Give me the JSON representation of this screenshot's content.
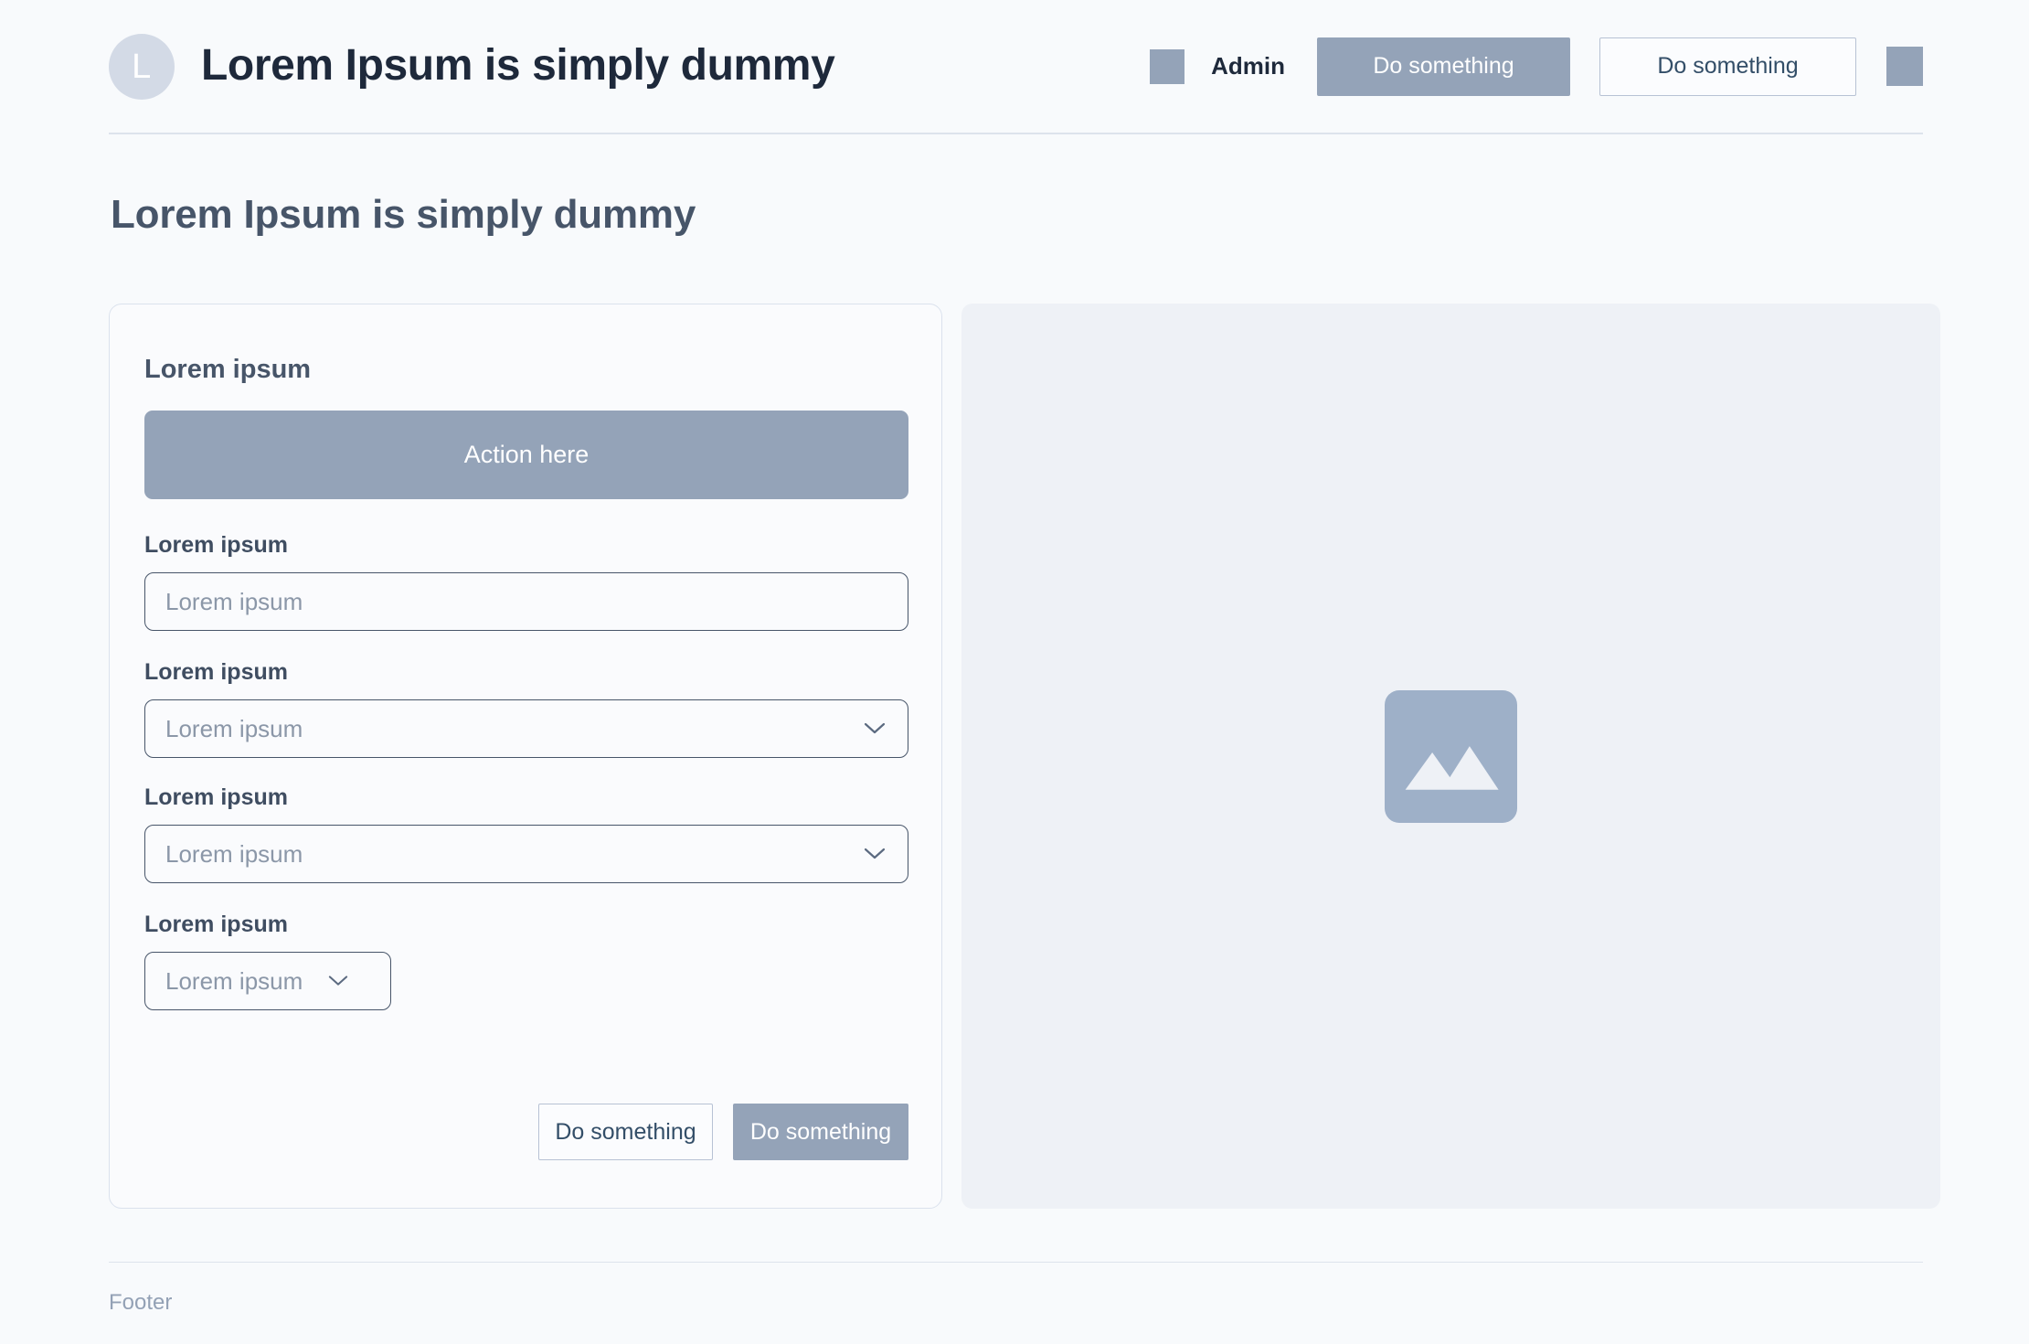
{
  "header": {
    "logo_initial": "L",
    "logo_icon": "avatar-letter-icon",
    "title": "Lorem Ipsum is simply dummy",
    "user_swatch_icon": "user-avatar-placeholder-icon",
    "user_label": "Admin",
    "primary_button": "Do something",
    "secondary_button": "Do something",
    "end_swatch_icon": "menu-placeholder-icon"
  },
  "page": {
    "title": "Lorem Ipsum is simply dummy"
  },
  "form_card": {
    "heading": "Lorem ipsum",
    "action_banner": "Action here",
    "fields": [
      {
        "label": "Lorem ipsum",
        "type": "text",
        "placeholder": "Lorem ipsum",
        "value": ""
      },
      {
        "label": "Lorem ipsum",
        "type": "select",
        "placeholder": "Lorem ipsum",
        "value": "Lorem ipsum",
        "chevron_icon": "chevron-down-icon"
      },
      {
        "label": "Lorem ipsum",
        "type": "select",
        "placeholder": "Lorem ipsum",
        "value": "Lorem ipsum",
        "chevron_icon": "chevron-down-icon"
      },
      {
        "label": "Lorem ipsum",
        "type": "select-small",
        "placeholder": "Lorem ipsum",
        "value": "Lorem ipsum",
        "chevron_icon": "chevron-down-icon"
      }
    ],
    "cancel_button": "Do something",
    "submit_button": "Do something"
  },
  "media_panel": {
    "placeholder_icon": "image-placeholder-icon"
  },
  "footer": {
    "text": "Footer"
  },
  "colors": {
    "page_background": "#f8fafc",
    "accent": "#94a3b8",
    "text_dark": "#1e293b",
    "text_muted": "#475569",
    "placeholder_text": "#8b97a8",
    "border": "#dde3ec",
    "control_border": "#475569",
    "media_panel_background": "#eef1f6",
    "logo_background": "#d3dae6"
  }
}
